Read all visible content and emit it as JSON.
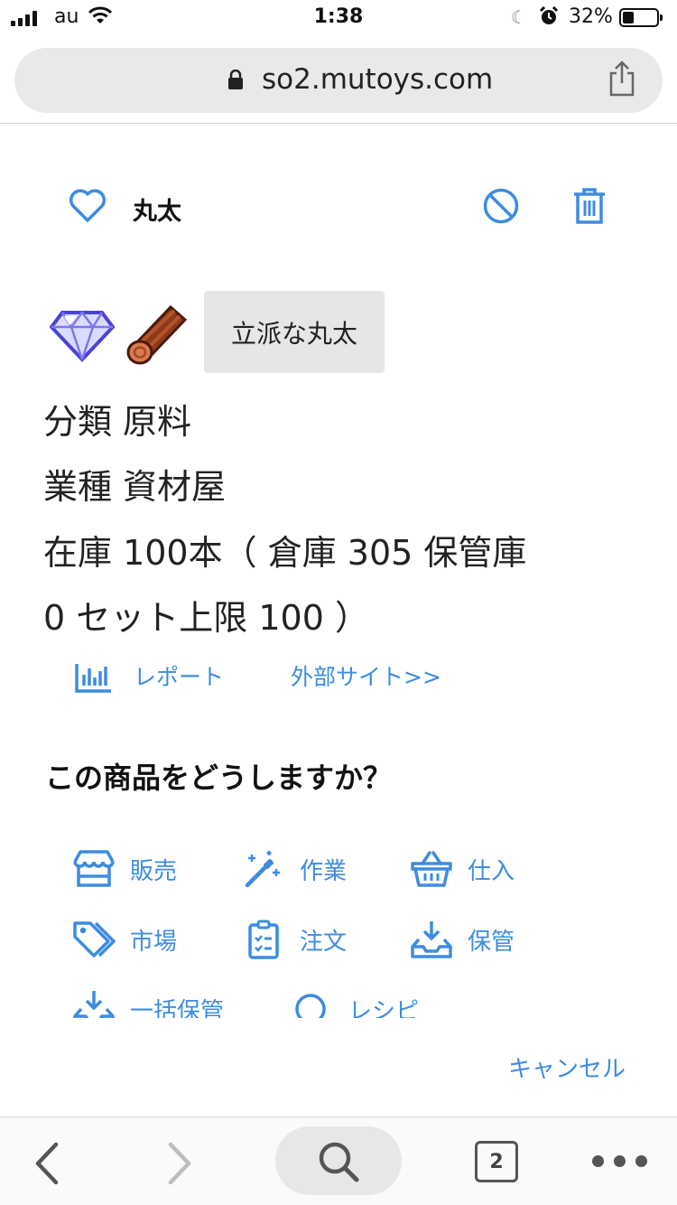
{
  "status_bar": {
    "carrier": "au",
    "time": "1:38",
    "battery": "32%",
    "battery_level": 0.32
  },
  "browser": {
    "url": "so2.mutoys.com",
    "tab_count": "2"
  },
  "item": {
    "title": "丸太",
    "quality_label": "立派な丸太",
    "category_label": "分類",
    "category_value": "原料",
    "industry_label": "業種",
    "industry_value": "資材屋",
    "stock_line1": "在庫 100本（ 倉庫 305 保管庫",
    "stock_line2": "0 セット上限 100 ）"
  },
  "links": {
    "report": "レポート",
    "external": "外部サイト>>"
  },
  "question": "この商品をどうしますか？",
  "actions": [
    {
      "label": "販売",
      "icon": "store-icon"
    },
    {
      "label": "作業",
      "icon": "magic-wand-icon"
    },
    {
      "label": "仕入",
      "icon": "basket-icon"
    },
    {
      "label": "市場",
      "icon": "tags-icon"
    },
    {
      "label": "注文",
      "icon": "clipboard-list-icon"
    },
    {
      "label": "保管",
      "icon": "inbox-download-icon"
    },
    {
      "label": "一括保管",
      "icon": "inbox-download-icon"
    },
    {
      "label": "レシピ",
      "icon": "search-icon"
    }
  ],
  "cancel": "キャンセル",
  "colors": {
    "accent": "#3d8ce0",
    "badge_bg": "#e6e6e6",
    "address_bg": "#e9e9eb"
  }
}
